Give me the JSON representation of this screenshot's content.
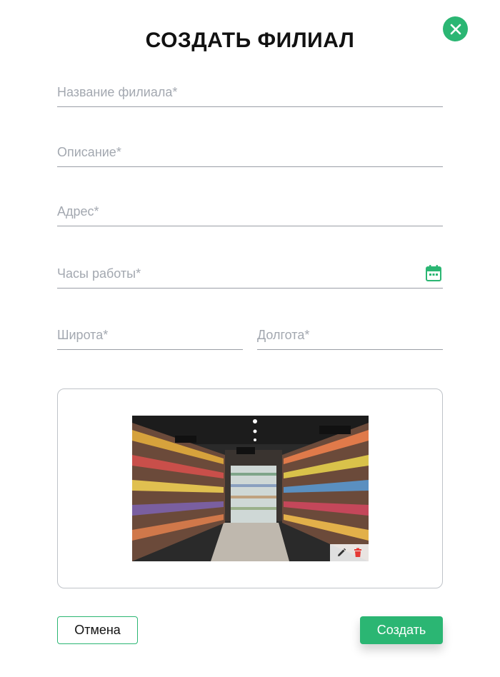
{
  "dialog": {
    "title": "СОЗДАТЬ ФИЛИАЛ"
  },
  "form": {
    "name_placeholder": "Название филиала*",
    "description_placeholder": "Описание*",
    "address_placeholder": "Адрес*",
    "hours_placeholder": "Часы работы*",
    "latitude_placeholder": "Широта*",
    "longitude_placeholder": "Долгота*"
  },
  "actions": {
    "cancel_label": "Отмена",
    "create_label": "Создать"
  },
  "icons": {
    "close": "close-icon",
    "calendar": "calendar-icon",
    "edit": "pencil-icon",
    "delete": "trash-icon"
  },
  "colors": {
    "accent": "#2bb673",
    "delete": "#e53935"
  }
}
